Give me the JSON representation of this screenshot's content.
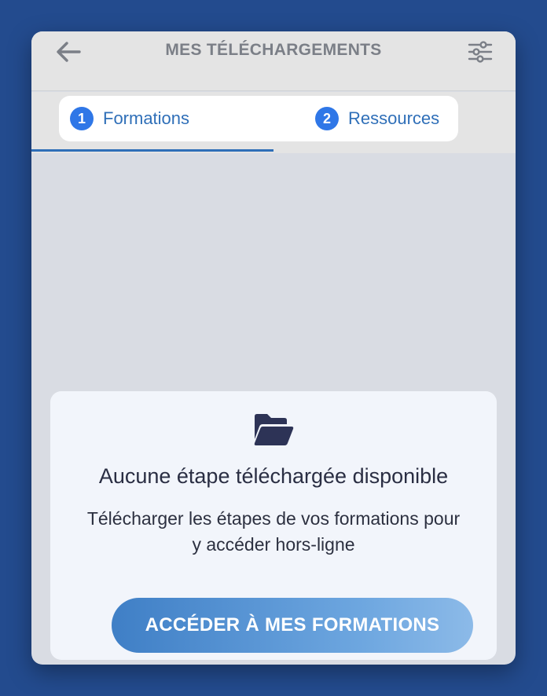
{
  "header": {
    "title": "MES TÉLÉCHARGEMENTS",
    "back_icon": "arrow-left-icon",
    "filter_icon": "sliders-icon"
  },
  "tabs": [
    {
      "number": "1",
      "label": "Formations",
      "active": true
    },
    {
      "number": "2",
      "label": "Ressources",
      "active": false
    }
  ],
  "empty_state": {
    "icon": "folder-open-icon",
    "title": "Aucune étape téléchargée disponible",
    "description": "Télécharger les étapes de vos formations pour y accéder hors-ligne",
    "button_label": "ACCÉDER À MES FORMATIONS"
  },
  "colors": {
    "background": "#234b8e",
    "accent": "#2f77e7",
    "tab_text": "#2f6fb8",
    "header_text": "#7b7f87",
    "card_bg": "#f2f5fb",
    "icon_dark": "#2d3356"
  }
}
